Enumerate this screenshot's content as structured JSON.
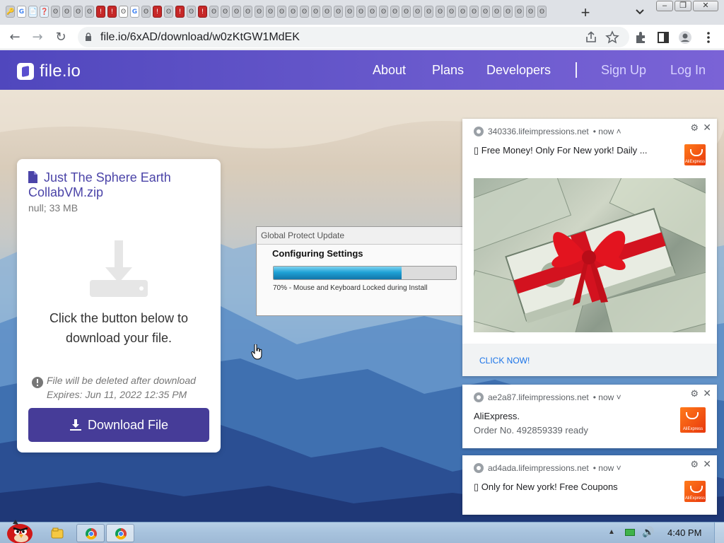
{
  "browser": {
    "new_tab_glyph": "+",
    "tab_search_glyph": "⌄",
    "url": "file.io/6xAD/download/w0zKtGW1MdEK",
    "tab_favicons": [
      "🔑",
      "G",
      "📄",
      "❓",
      "ʘ",
      "ʘ",
      "ʘ",
      "ʘ",
      "!",
      "!",
      "ʘ",
      "G",
      "ʘ",
      "!",
      "ʘ",
      "!",
      "ʘ",
      "!",
      "ʘ",
      "ʘ",
      "ʘ",
      "ʘ",
      "ʘ",
      "ʘ",
      "ʘ",
      "ʘ",
      "ʘ",
      "ʘ",
      "ʘ",
      "ʘ",
      "ʘ",
      "ʘ",
      "ʘ",
      "ʘ",
      "ʘ",
      "ʘ",
      "ʘ",
      "ʘ",
      "ʘ",
      "ʘ",
      "ʘ",
      "ʘ",
      "ʘ",
      "ʘ",
      "ʘ",
      "ʘ",
      "ʘ",
      "ʘ"
    ],
    "window_buttons": [
      "–",
      "❐",
      "✕"
    ],
    "nav": {
      "back": "←",
      "forward": "→",
      "reload": "↻"
    },
    "toolbar_icons": [
      "share-icon",
      "star-icon",
      "extensions-icon",
      "sidepanel-icon",
      "profile-icon",
      "menu-icon"
    ]
  },
  "site": {
    "logo_text": "file.io",
    "nav": {
      "about": "About",
      "plans": "Plans",
      "developers": "Developers",
      "divider": "|",
      "signup": "Sign Up",
      "login": "Log In"
    },
    "colors": {
      "header": "#5a4fcf",
      "button": "#463c98",
      "link": "#4b44a8"
    }
  },
  "card": {
    "file_name": "Just The Sphere Earth CollabVM.zip",
    "file_meta": "null; 33 MB",
    "instruction": "Click the button below to download your file.",
    "delete_note": "File will be deleted after download",
    "expires_note": "Expires: Jun 11, 2022 12:35 PM",
    "download_button": "Download File"
  },
  "global_protect": {
    "title": "Global Protect Update",
    "heading": "Configuring Settings",
    "progress": 0.7,
    "status": "70% - Mouse and Keyboard Locked during Install"
  },
  "notifications": [
    {
      "source": "340336.lifeimpressions.net",
      "time": "• now ˄",
      "title": "▯ Free Money! Only For New york! Daily ...",
      "cta": "CLICK NOW!",
      "image": "money-gift-image"
    },
    {
      "source": "ae2a87.lifeimpressions.net",
      "time": "• now ˅",
      "title": "AliExpress.",
      "body": "Order No. 492859339 ready"
    },
    {
      "source": "ad4ada.lifeimpressions.net",
      "time": "• now ˅",
      "title": "▯ Only for New york! Free Coupons"
    }
  ],
  "notification_controls": {
    "gear": "⚙",
    "close": "✕"
  },
  "ali_badge_text": "AliExpress",
  "taskbar": {
    "clock": "4:40 PM",
    "tray_arrow": "▲",
    "volume": "🔊"
  }
}
